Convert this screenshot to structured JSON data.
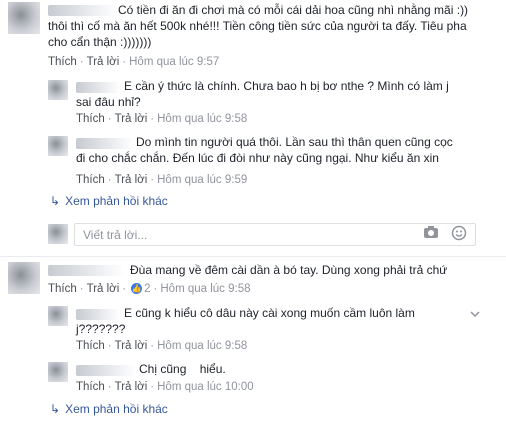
{
  "c1": {
    "text": "Có tiền đi ăn đi chơi mà có mỗi cái dải hoa cũng nhì nhằng mãi :))\nthôi thì cố mà ăn hết 500k nhé!!! Tiền công tiền sức của người ta đấy. Tiêu pha\ncho cẩn thận :)))))))",
    "like": "Thích",
    "reply": "Trả lời",
    "time": "Hôm qua lúc 9:57"
  },
  "r1": {
    "text": "E cần ý thức là chính. Chưa bao h bị bơ nthe ? Mình có làm j\nsai đâu nhỉ?",
    "like": "Thích",
    "reply": "Trả lời",
    "time": "Hôm qua lúc 9:58"
  },
  "r2": {
    "text": "Do mình tin người quá thôi. Lần sau thì thân quen cũng cọc\nđi cho chắc chắn. Đến lúc đi đòi như này cũng ngại. Như kiểu ăn xin",
    "like": "Thích",
    "reply": "Trả lời",
    "time": "Hôm qua lúc 9:59"
  },
  "more1": "Xem phản hồi khác",
  "write": {
    "placeholder": "Viết trả lời..."
  },
  "c2": {
    "text": "Đùa mang về đêm cài dần à bó tay. Dùng xong phải trả chứ",
    "like": "Thích",
    "reply": "Trả lời",
    "reactions": "2",
    "time": "Hôm qua lúc 9:58"
  },
  "r3": {
    "text": "E cũng k hiểu cô dâu này cài xong muốn cầm luôn làm\nj???????",
    "like": "Thích",
    "reply": "Trả lời",
    "time": "Hôm qua lúc 9:58"
  },
  "r4": {
    "text": "Chị cũng    hiểu.",
    "like": "Thích",
    "reply": "Trả lời",
    "time": "Hôm qua lúc 10:00"
  },
  "more2": "Xem phản hồi khác",
  "icons": {
    "camera": "camera-icon",
    "emoji": "emoji-icon",
    "chevron": "chevron-down-icon",
    "reply_arrow": "reply-arrow-icon"
  }
}
